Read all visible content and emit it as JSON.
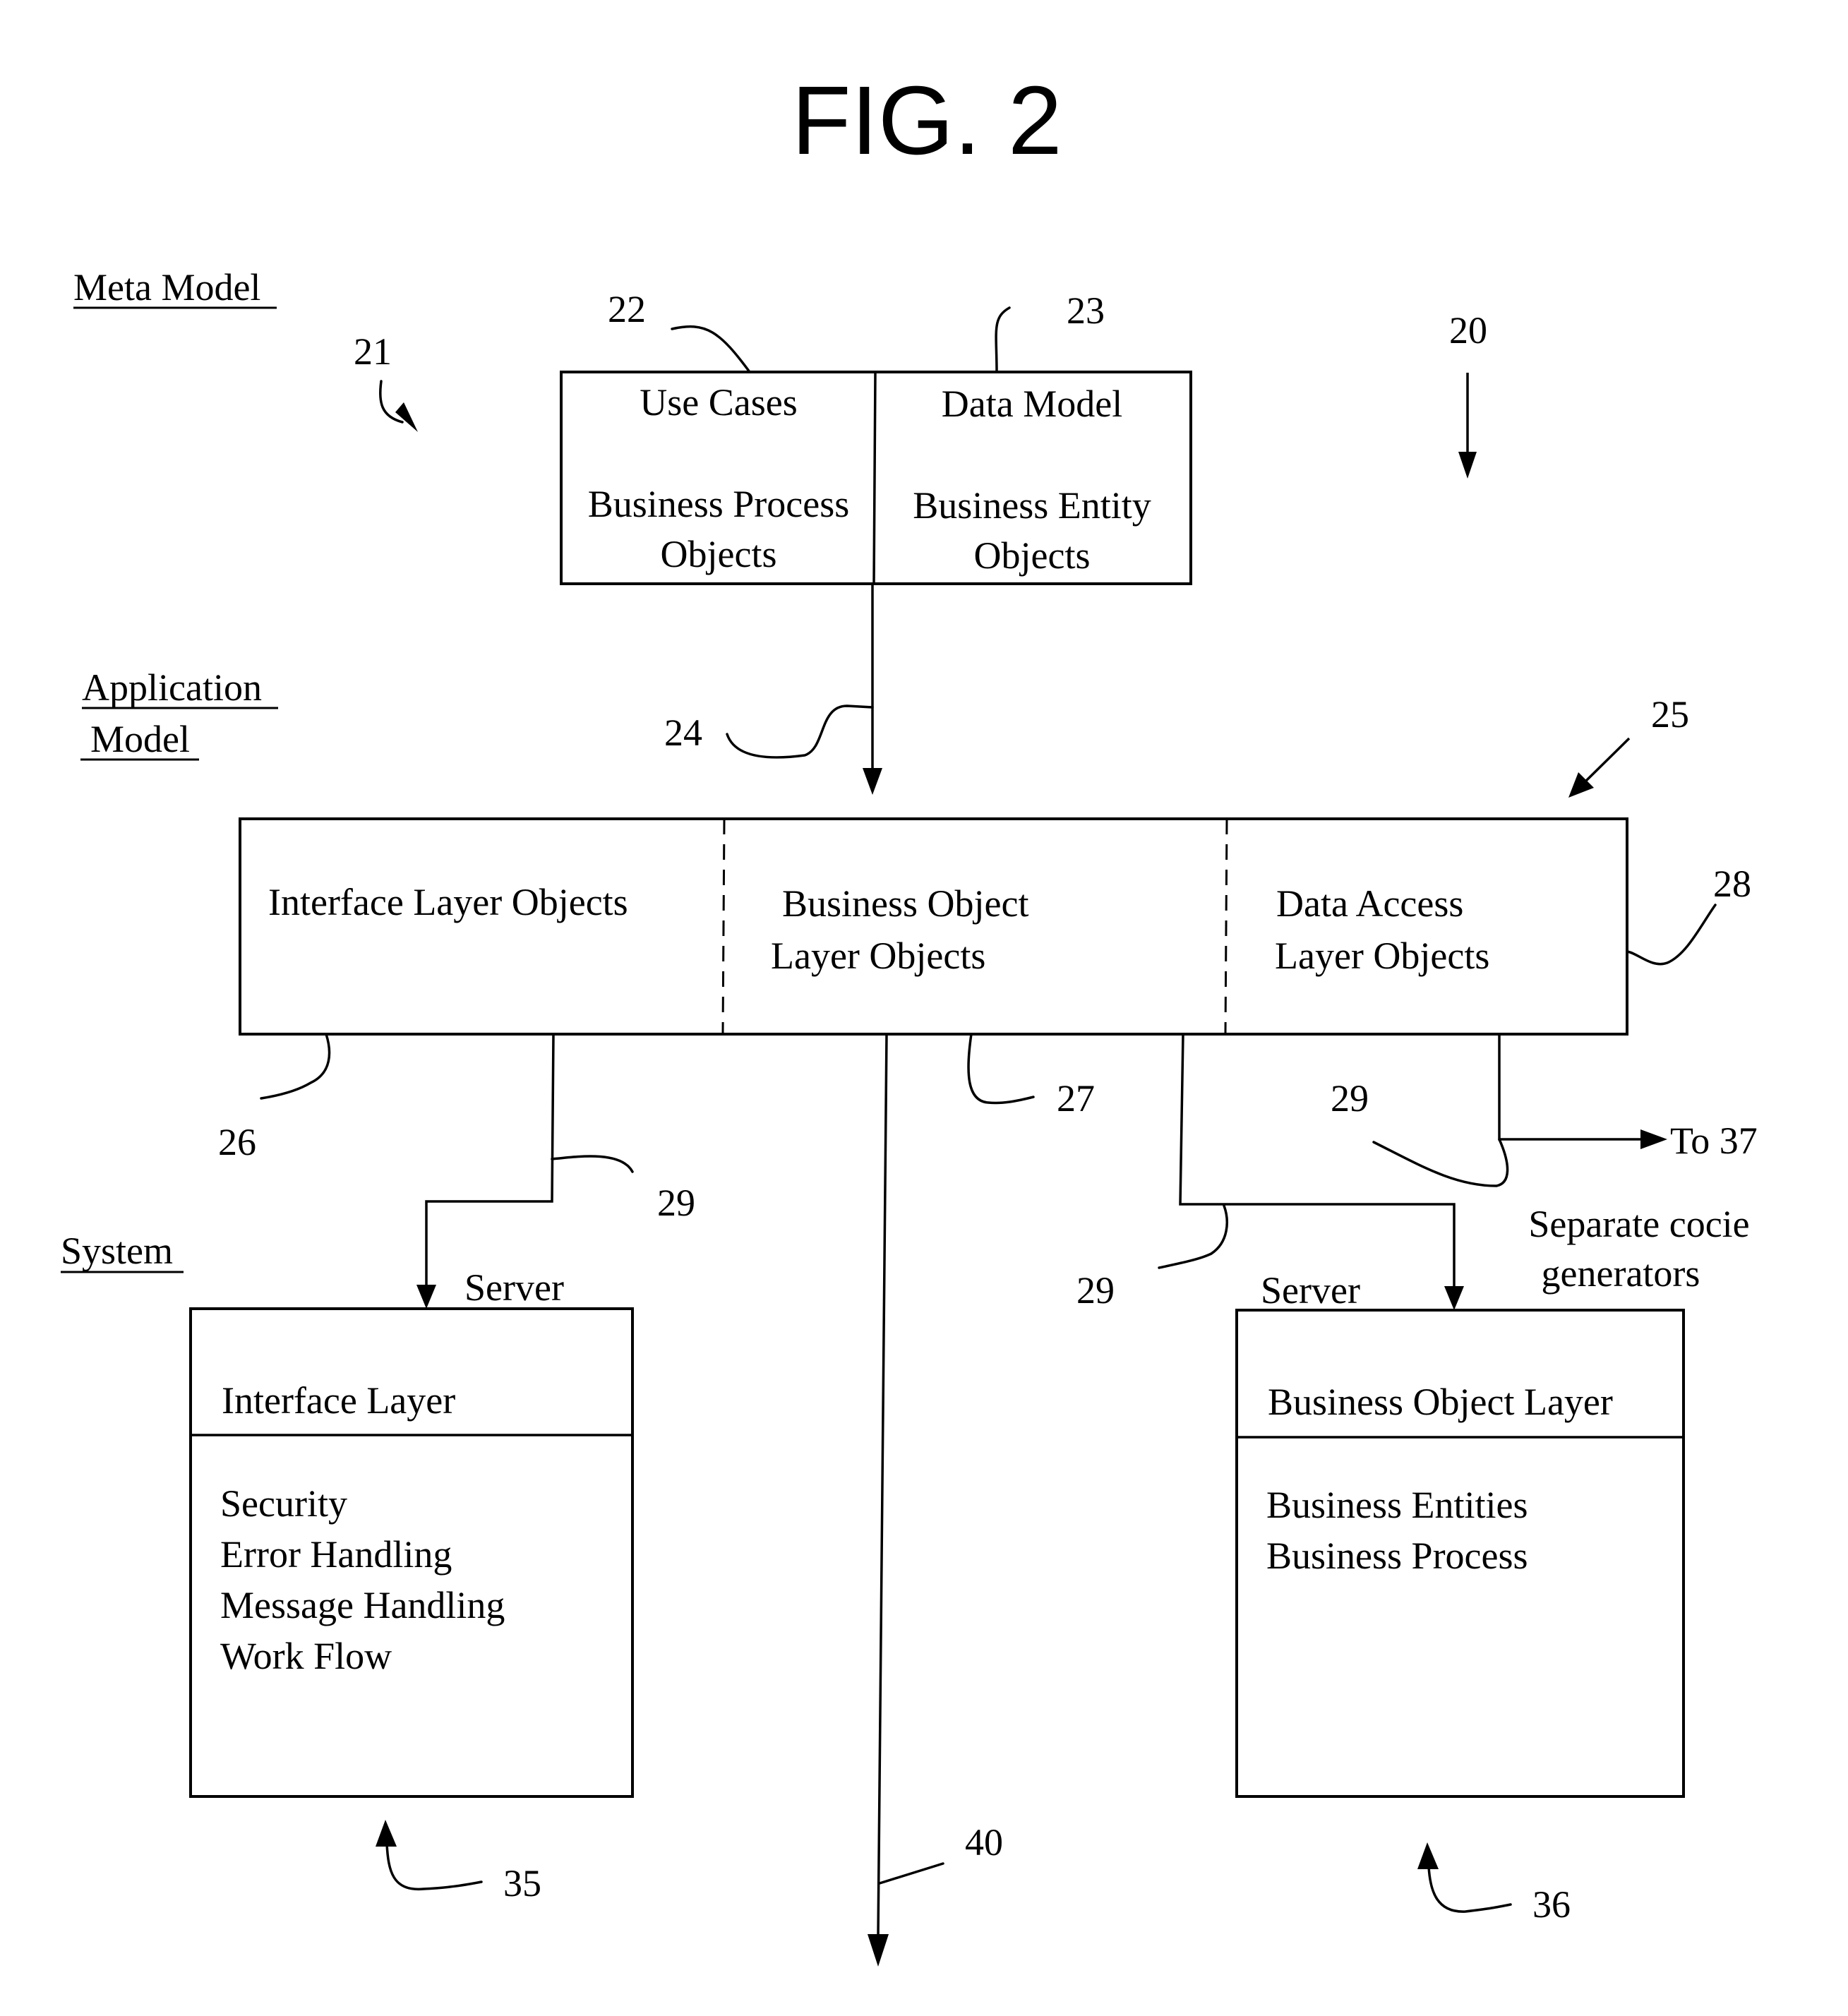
{
  "figure": {
    "title": "FIG. 2",
    "ref_overall": "20"
  },
  "sections": {
    "meta_model": "Meta Model",
    "application_model_line1": "Application",
    "application_model_line2": "Model",
    "system": "System"
  },
  "meta_box": {
    "ref_group": "21",
    "left": {
      "ref": "22",
      "title": "Use Cases",
      "line1": "Business Process",
      "line2": "Objects"
    },
    "right": {
      "ref": "23",
      "title": "Data Model",
      "line1": "Business Entity",
      "line2": "Objects"
    }
  },
  "arrow_24": {
    "ref": "24"
  },
  "app_box": {
    "ref_group": "25",
    "ref_right": "28",
    "cells": [
      {
        "ref": "26",
        "line1": "Interface Layer Objects",
        "line2": ""
      },
      {
        "ref": "27",
        "line1": "Business Object",
        "line2": "Layer Objects"
      },
      {
        "ref": "28",
        "line1": "Data Access",
        "line2": "Layer Objects"
      }
    ]
  },
  "generators": {
    "ref": "29",
    "to_label": "To 37",
    "note_line1": "Separate cocie",
    "note_line2": "generators"
  },
  "system_boxes": {
    "left": {
      "ref": "35",
      "server_label": "Server",
      "header": "Interface Layer",
      "items": [
        "Security",
        "Error Handling",
        "Message Handling",
        "Work Flow"
      ]
    },
    "right": {
      "ref": "36",
      "server_label": "Server",
      "header": "Business Object Layer",
      "items": [
        "Business Entities",
        "Business Process"
      ]
    }
  },
  "arrow_40": {
    "ref": "40"
  }
}
